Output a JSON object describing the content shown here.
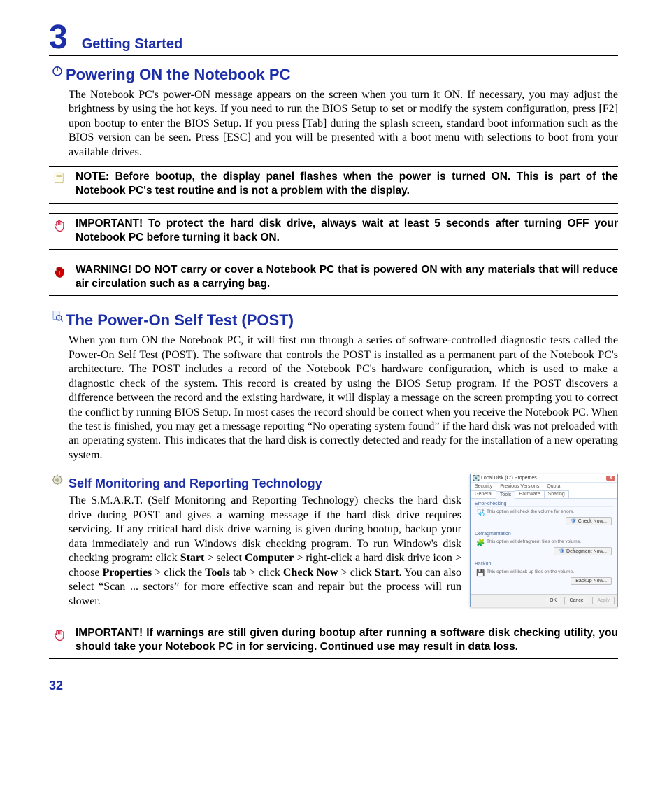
{
  "chapter": {
    "number": "3",
    "title": "Getting Started"
  },
  "section_power": {
    "heading": "Powering ON the Notebook PC",
    "body": "The Notebook PC's power-ON message appears on the screen when you turn it ON. If necessary, you may adjust the brightness by using the hot keys. If you need to run the BIOS Setup to set or modify the system configuration, press [F2] upon bootup to enter the BIOS Setup. If you press [Tab] during the splash screen, standard boot information such as the BIOS version can be seen. Press [ESC] and you will be presented with a boot menu with selections to boot from your available drives."
  },
  "callout_note": {
    "text": "NOTE:  Before bootup, the display panel flashes when the power is turned ON. This is part of the Notebook PC's test routine and is not a problem with the display."
  },
  "callout_important1": {
    "text": "IMPORTANT!  To protect the hard disk drive, always wait at least 5 seconds after turning OFF your Notebook PC before turning it back ON."
  },
  "callout_warning": {
    "text": "WARNING! DO NOT carry or cover a Notebook PC that is powered ON with any materials that will reduce air circulation such as a carrying bag."
  },
  "section_post": {
    "heading": "The Power-On Self Test (POST)",
    "body": "When you turn ON the Notebook PC, it will first run through a series of software-controlled diagnostic tests called the Power-On Self Test (POST). The software that controls the POST is installed as a permanent part of the Notebook PC's architecture. The POST includes a record of the Notebook PC's hardware configuration, which is used to make a diagnostic check of the system. This record is created by using the BIOS Setup program. If the POST discovers a difference between the record and the existing hardware, it will display a message on the screen prompting you to correct the conflict by running BIOS Setup. In most cases the record should be correct when you receive the Notebook PC. When the test is finished, you may get a message reporting “No operating system found” if the hard disk was not preloaded with an operating system. This indicates that the hard disk is correctly detected and ready for the installation of a new operating system."
  },
  "section_smart": {
    "heading": "Self Monitoring and Reporting Technology",
    "p1": "The S.M.A.R.T. (Self Monitoring and Reporting Technology) checks the hard disk drive during POST and gives a warning message if the hard disk drive requires servicing. If any critical hard disk drive warning is given during bootup, backup your data immediately and run Windows disk checking program. To run Window's disk checking program: click ",
    "b1": "Start",
    "p2": " > select ",
    "b2": "Computer",
    "p3": " > right-click a hard disk drive icon > choose ",
    "b3": "Properties",
    "p4": " > click the ",
    "b4": "Tools",
    "p5": " tab > click ",
    "b5": "Check Now",
    "p6": " > click ",
    "b6": "Start",
    "p7": ". You can also select “Scan ... sectors” for more effective scan and repair but the process will run slower."
  },
  "callout_important2": {
    "text": "IMPORTANT! If warnings are still given during bootup after running a software disk checking utility, you should take your Notebook PC in for servicing. Continued use may result in data loss."
  },
  "dialog": {
    "title": "Local Disk (C:) Properties",
    "close": "X",
    "tabs_row1": [
      "Security",
      "Previous Versions",
      "Quota"
    ],
    "tabs_row2": [
      "General",
      "Tools",
      "Hardware",
      "Sharing"
    ],
    "active_tab": "Tools",
    "groups": [
      {
        "label": "Error-checking",
        "desc": "This option will check the volume for errors.",
        "button": "Check Now..."
      },
      {
        "label": "Defragmentation",
        "desc": "This option will defragment files on the volume.",
        "button": "Defragment Now..."
      },
      {
        "label": "Backup",
        "desc": "This option will back up files on the volume.",
        "button": "Backup Now..."
      }
    ],
    "footer": {
      "ok": "OK",
      "cancel": "Cancel",
      "apply": "Apply"
    }
  },
  "page_number": "32"
}
